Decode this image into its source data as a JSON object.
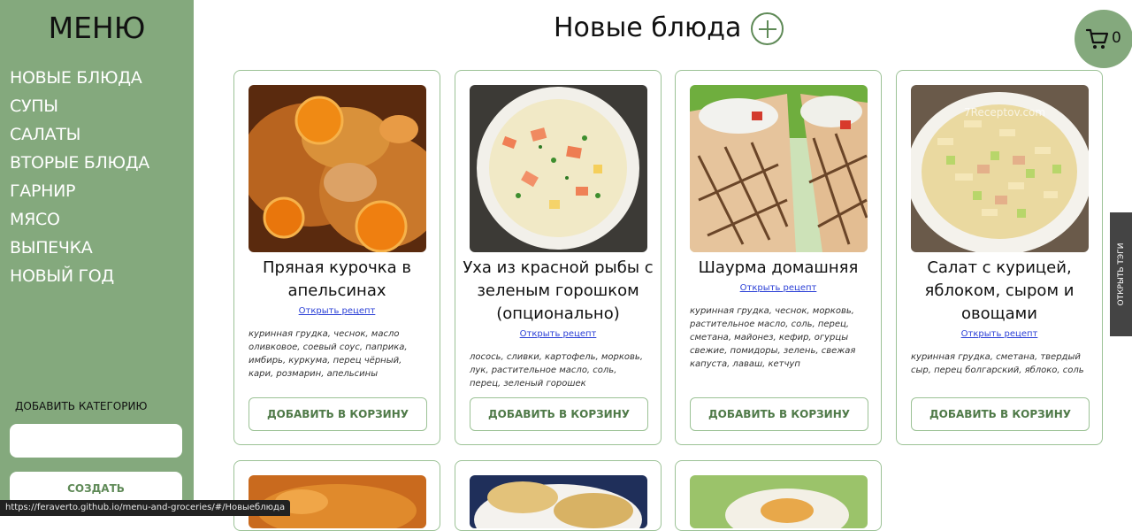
{
  "sidebar": {
    "title": "МЕНЮ",
    "items": [
      "НОВЫЕ БЛЮДА",
      "СУПЫ",
      "САЛАТЫ",
      "ВТОРЫЕ БЛЮДА",
      "ГАРНИР",
      "МЯСО",
      "ВЫПЕЧКА",
      "НОВЫЙ ГОД"
    ],
    "add_category_label": "ДОБАВИТЬ КАТЕГОРИЮ",
    "add_category_placeholder": "",
    "create_button": "СОЗДАТЬ"
  },
  "header": {
    "title": "Новые блюда",
    "cart_count": "0"
  },
  "cards": [
    {
      "name": "Пряная курочка в апельсинах",
      "link": "Открыть рецепт",
      "ingredients": "куринная грудка, чеснок, масло оливковое, соевый соус, паприка, имбирь, куркума, перец чёрный, кари, розмарин, апельсины",
      "button": "ДОБАВИТЬ В КОРЗИНУ"
    },
    {
      "name": "Уха из красной рыбы с зеленым горошком (опционально)",
      "link": "Открыть рецепт",
      "ingredients": "лосось, сливки, картофель, морковь, лук, растительное масло, соль, перец, зеленый горошек",
      "button": "ДОБАВИТЬ В КОРЗИНУ"
    },
    {
      "name": "Шаурма домашняя",
      "link": "Открыть рецепт",
      "ingredients": "куринная грудка, чеснок, морковь, растительное масло, соль, перец, сметана, майонез, кефир, огурцы свежие, помидоры, зелень, свежая капуста, лаваш, кетчуп",
      "button": "ДОБАВИТЬ В КОРЗИНУ"
    },
    {
      "name": "Салат с курицей, яблоком, сыром и овощами",
      "link": "Открыть рецепт",
      "ingredients": "куринная грудка, сметана, твердый сыр, перец болгарский, яблоко, соль",
      "button": "ДОБАВИТЬ В КОРЗИНУ"
    }
  ],
  "tags_tab": "ОТКРЫТЬ ТЭГИ",
  "status_url": "https://feraverto.github.io/menu-and-groceries/#/Новыеблюда",
  "colors": {
    "accent": "#84a97d",
    "button_text": "#4f7a48",
    "link": "#2a3fd6"
  }
}
